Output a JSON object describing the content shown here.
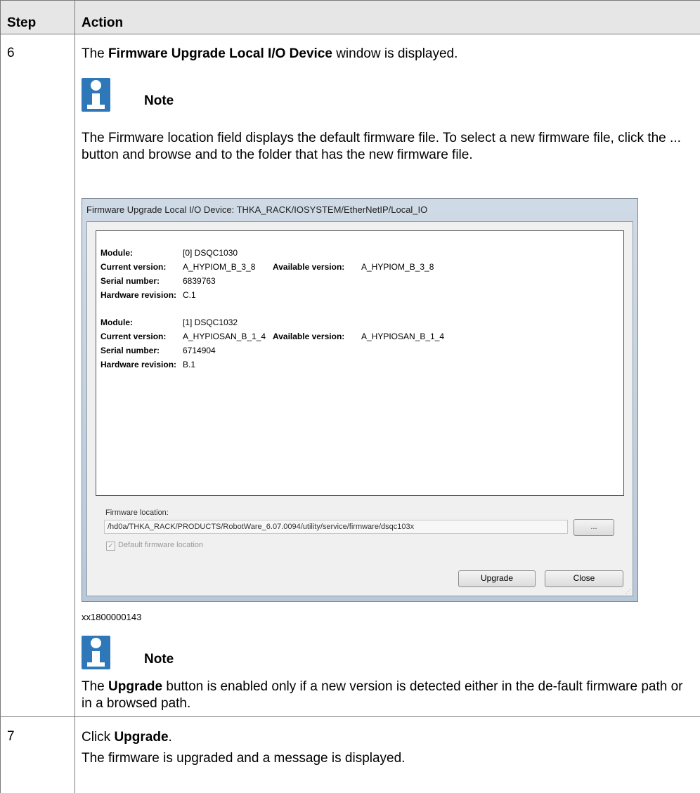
{
  "header": {
    "step": "Step",
    "action": "Action"
  },
  "step6": {
    "number": "6",
    "intro_pre": "The ",
    "intro_bold": "Firmware Upgrade Local I/O Device",
    "intro_post": " window is displayed.",
    "note1_label": "Note",
    "note1_text": "The Firmware location field displays the default firmware file. To select a new firmware file, click the ... button and browse and to the folder that has the new firmware file.",
    "caption": "xx1800000143",
    "note2_label": "Note",
    "note2_pre": "The ",
    "note2_bold": "Upgrade",
    "note2_post": " button is enabled only if a new version is detected either in the de-fault firmware path or in a browsed path."
  },
  "dialog": {
    "title": "Firmware Upgrade Local I/O Device: THKA_RACK/IOSYSTEM/EtherNetIP/Local_IO",
    "labels": {
      "module": "Module:",
      "current": "Current version:",
      "available": "Available version:",
      "serial": "Serial number:",
      "hardware": "Hardware revision:"
    },
    "modules": [
      {
        "module": "[0] DSQC1030",
        "current": "A_HYPIOM_B_3_8",
        "available": "A_HYPIOM_B_3_8",
        "serial": "6839763",
        "hardware": "C.1"
      },
      {
        "module": "[1] DSQC1032",
        "current": "A_HYPIOSAN_B_1_4",
        "available": "A_HYPIOSAN_B_1_4",
        "serial": "6714904",
        "hardware": "B.1"
      }
    ],
    "firmware_location_label": "Firmware location:",
    "firmware_location_value": "/hd0a/THKA_RACK/PRODUCTS/RobotWare_6.07.0094/utility/service/firmware/dsqc103x",
    "browse_label": "...",
    "default_location_label": "Default firmware location",
    "upgrade_label": "Upgrade",
    "close_label": "Close"
  },
  "step7": {
    "number": "7",
    "line1_pre": "Click ",
    "line1_bold": "Upgrade",
    "line1_post": ".",
    "line2": "The firmware is upgraded and a message is displayed."
  }
}
